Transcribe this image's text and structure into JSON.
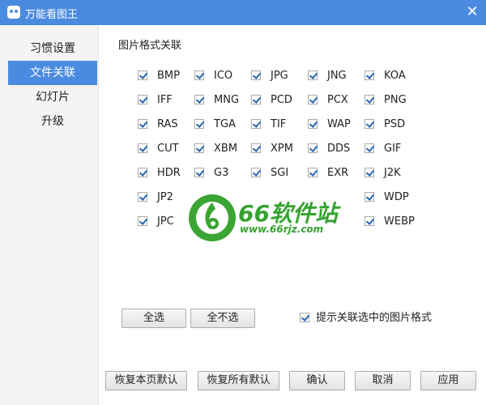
{
  "window": {
    "title": "万能看图王",
    "close_glyph": "✕"
  },
  "sidebar": {
    "items": [
      {
        "label": "习惯设置"
      },
      {
        "label": "文件关联"
      },
      {
        "label": "幻灯片"
      },
      {
        "label": "升级"
      }
    ],
    "active_index": 1
  },
  "section": {
    "title": "图片格式关联"
  },
  "formats": {
    "row0": [
      "BMP",
      "ICO",
      "JPG",
      "JNG",
      "KOA"
    ],
    "row1": [
      "IFF",
      "MNG",
      "PCD",
      "PCX",
      "PNG"
    ],
    "row2": [
      "RAS",
      "TGA",
      "TIF",
      "WAP",
      "PSD"
    ],
    "row3": [
      "CUT",
      "XBM",
      "XPM",
      "DDS",
      "GIF"
    ],
    "row4": [
      "HDR",
      "G3",
      "SGI",
      "EXR",
      "J2K"
    ],
    "row5": [
      "JP2",
      "WDP"
    ],
    "row6": [
      "JPC",
      "WEBP"
    ],
    "all_checked": true
  },
  "selection": {
    "select_all": "全选",
    "select_none": "全不选",
    "hint_checkbox": "提示关联选中的图片格式",
    "hint_checked": true
  },
  "footer": {
    "restore_page": "恢复本页默认",
    "restore_all": "恢复所有默认",
    "ok": "确认",
    "cancel": "取消",
    "apply": "应用"
  },
  "watermark": {
    "main": "66软件站",
    "sub": "www.66rjz.com"
  },
  "colors": {
    "accent": "#4a8be0",
    "check": "#2a63b0",
    "watermark": "#35a32f"
  }
}
